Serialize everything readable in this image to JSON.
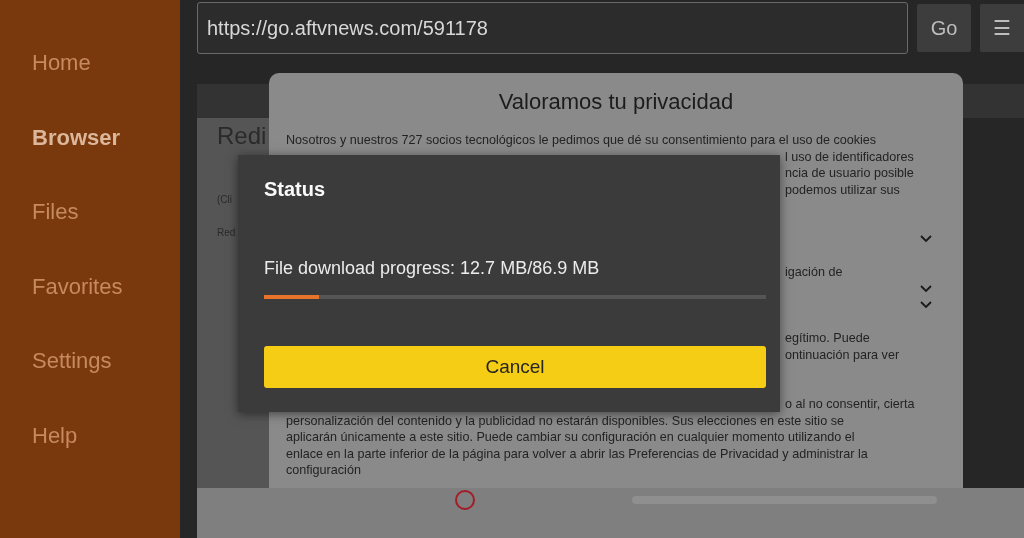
{
  "sidebar": {
    "items": [
      {
        "label": "Home",
        "selected": false
      },
      {
        "label": "Browser",
        "selected": true
      },
      {
        "label": "Files",
        "selected": false
      },
      {
        "label": "Favorites",
        "selected": false
      },
      {
        "label": "Settings",
        "selected": false
      },
      {
        "label": "Help",
        "selected": false
      }
    ]
  },
  "address_bar": {
    "value": "https://go.aftvnews.com/591178",
    "go_button": "Go",
    "menu_button": "☰"
  },
  "page": {
    "heading": "Redi",
    "lines": [
      "(Cli",
      "Red"
    ]
  },
  "privacy": {
    "title": "Valoramos tu privacidad",
    "rows": [
      {
        "kind": "line",
        "text": "Nosotros y nuestros 727 socios tecnológicos le pedimos que dé su consentimiento para el uso de cookies"
      },
      {
        "kind": "fragment",
        "text": "l uso de identificadores"
      },
      {
        "kind": "fragment",
        "text": "ncia de usuario posible"
      },
      {
        "kind": "fragment",
        "text": "podemos utilizar sus"
      },
      {
        "kind": "blank"
      },
      {
        "kind": "blank"
      },
      {
        "kind": "chevron"
      },
      {
        "kind": "blank"
      },
      {
        "kind": "fragment",
        "text": "igación de"
      },
      {
        "kind": "chevron"
      },
      {
        "kind": "chevron"
      },
      {
        "kind": "blank"
      },
      {
        "kind": "fragment",
        "text": "egítimo. Puede"
      },
      {
        "kind": "fragment",
        "text": "ontinuación para ver"
      },
      {
        "kind": "blank"
      },
      {
        "kind": "blank"
      },
      {
        "kind": "fragment",
        "text": "o al no consentir, cierta"
      },
      {
        "kind": "line",
        "text": "personalización del contenido y la publicidad no estarán disponibles. Sus elecciones en este sitio se"
      },
      {
        "kind": "line",
        "text": "aplicarán únicamente a este sitio. Puede cambiar su configuración en cualquier momento utilizando el"
      },
      {
        "kind": "line",
        "text": "enlace en la parte inferior de la página para volver a abrir las Preferencias de Privacidad y administrar la"
      },
      {
        "kind": "line",
        "text": "configuración"
      }
    ]
  },
  "status_dialog": {
    "title": "Status",
    "message": "File download progress: 12.7 MB/86.9 MB",
    "level": 0.11,
    "button": "Cancel"
  }
}
